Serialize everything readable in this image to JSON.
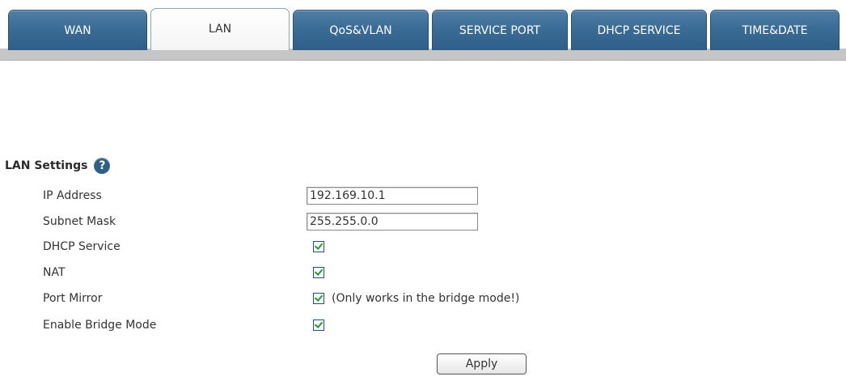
{
  "tabs": [
    {
      "label": "WAN",
      "active": false
    },
    {
      "label": "LAN",
      "active": true
    },
    {
      "label": "QoS&VLAN",
      "active": false
    },
    {
      "label": "SERVICE PORT",
      "active": false
    },
    {
      "label": "DHCP SERVICE",
      "active": false
    },
    {
      "label": "TIME&DATE",
      "active": false
    }
  ],
  "section": {
    "title": "LAN Settings",
    "help_icon": "?"
  },
  "fields": {
    "ip_address": {
      "label": "IP Address",
      "value": "192.169.10.1"
    },
    "subnet_mask": {
      "label": "Subnet Mask",
      "value": "255.255.0.0"
    },
    "dhcp_service": {
      "label": "DHCP Service",
      "checked": true
    },
    "nat": {
      "label": "NAT",
      "checked": true
    },
    "port_mirror": {
      "label": "Port Mirror",
      "checked": true,
      "note": "(Only works in the bridge mode!)"
    },
    "bridge_mode": {
      "label": "Enable Bridge Mode",
      "checked": true
    }
  },
  "apply_label": "Apply",
  "colors": {
    "tab_blue": "#3a6c95",
    "tab_strip": "#c6c6c6",
    "check_green": "#2a9a2a"
  }
}
